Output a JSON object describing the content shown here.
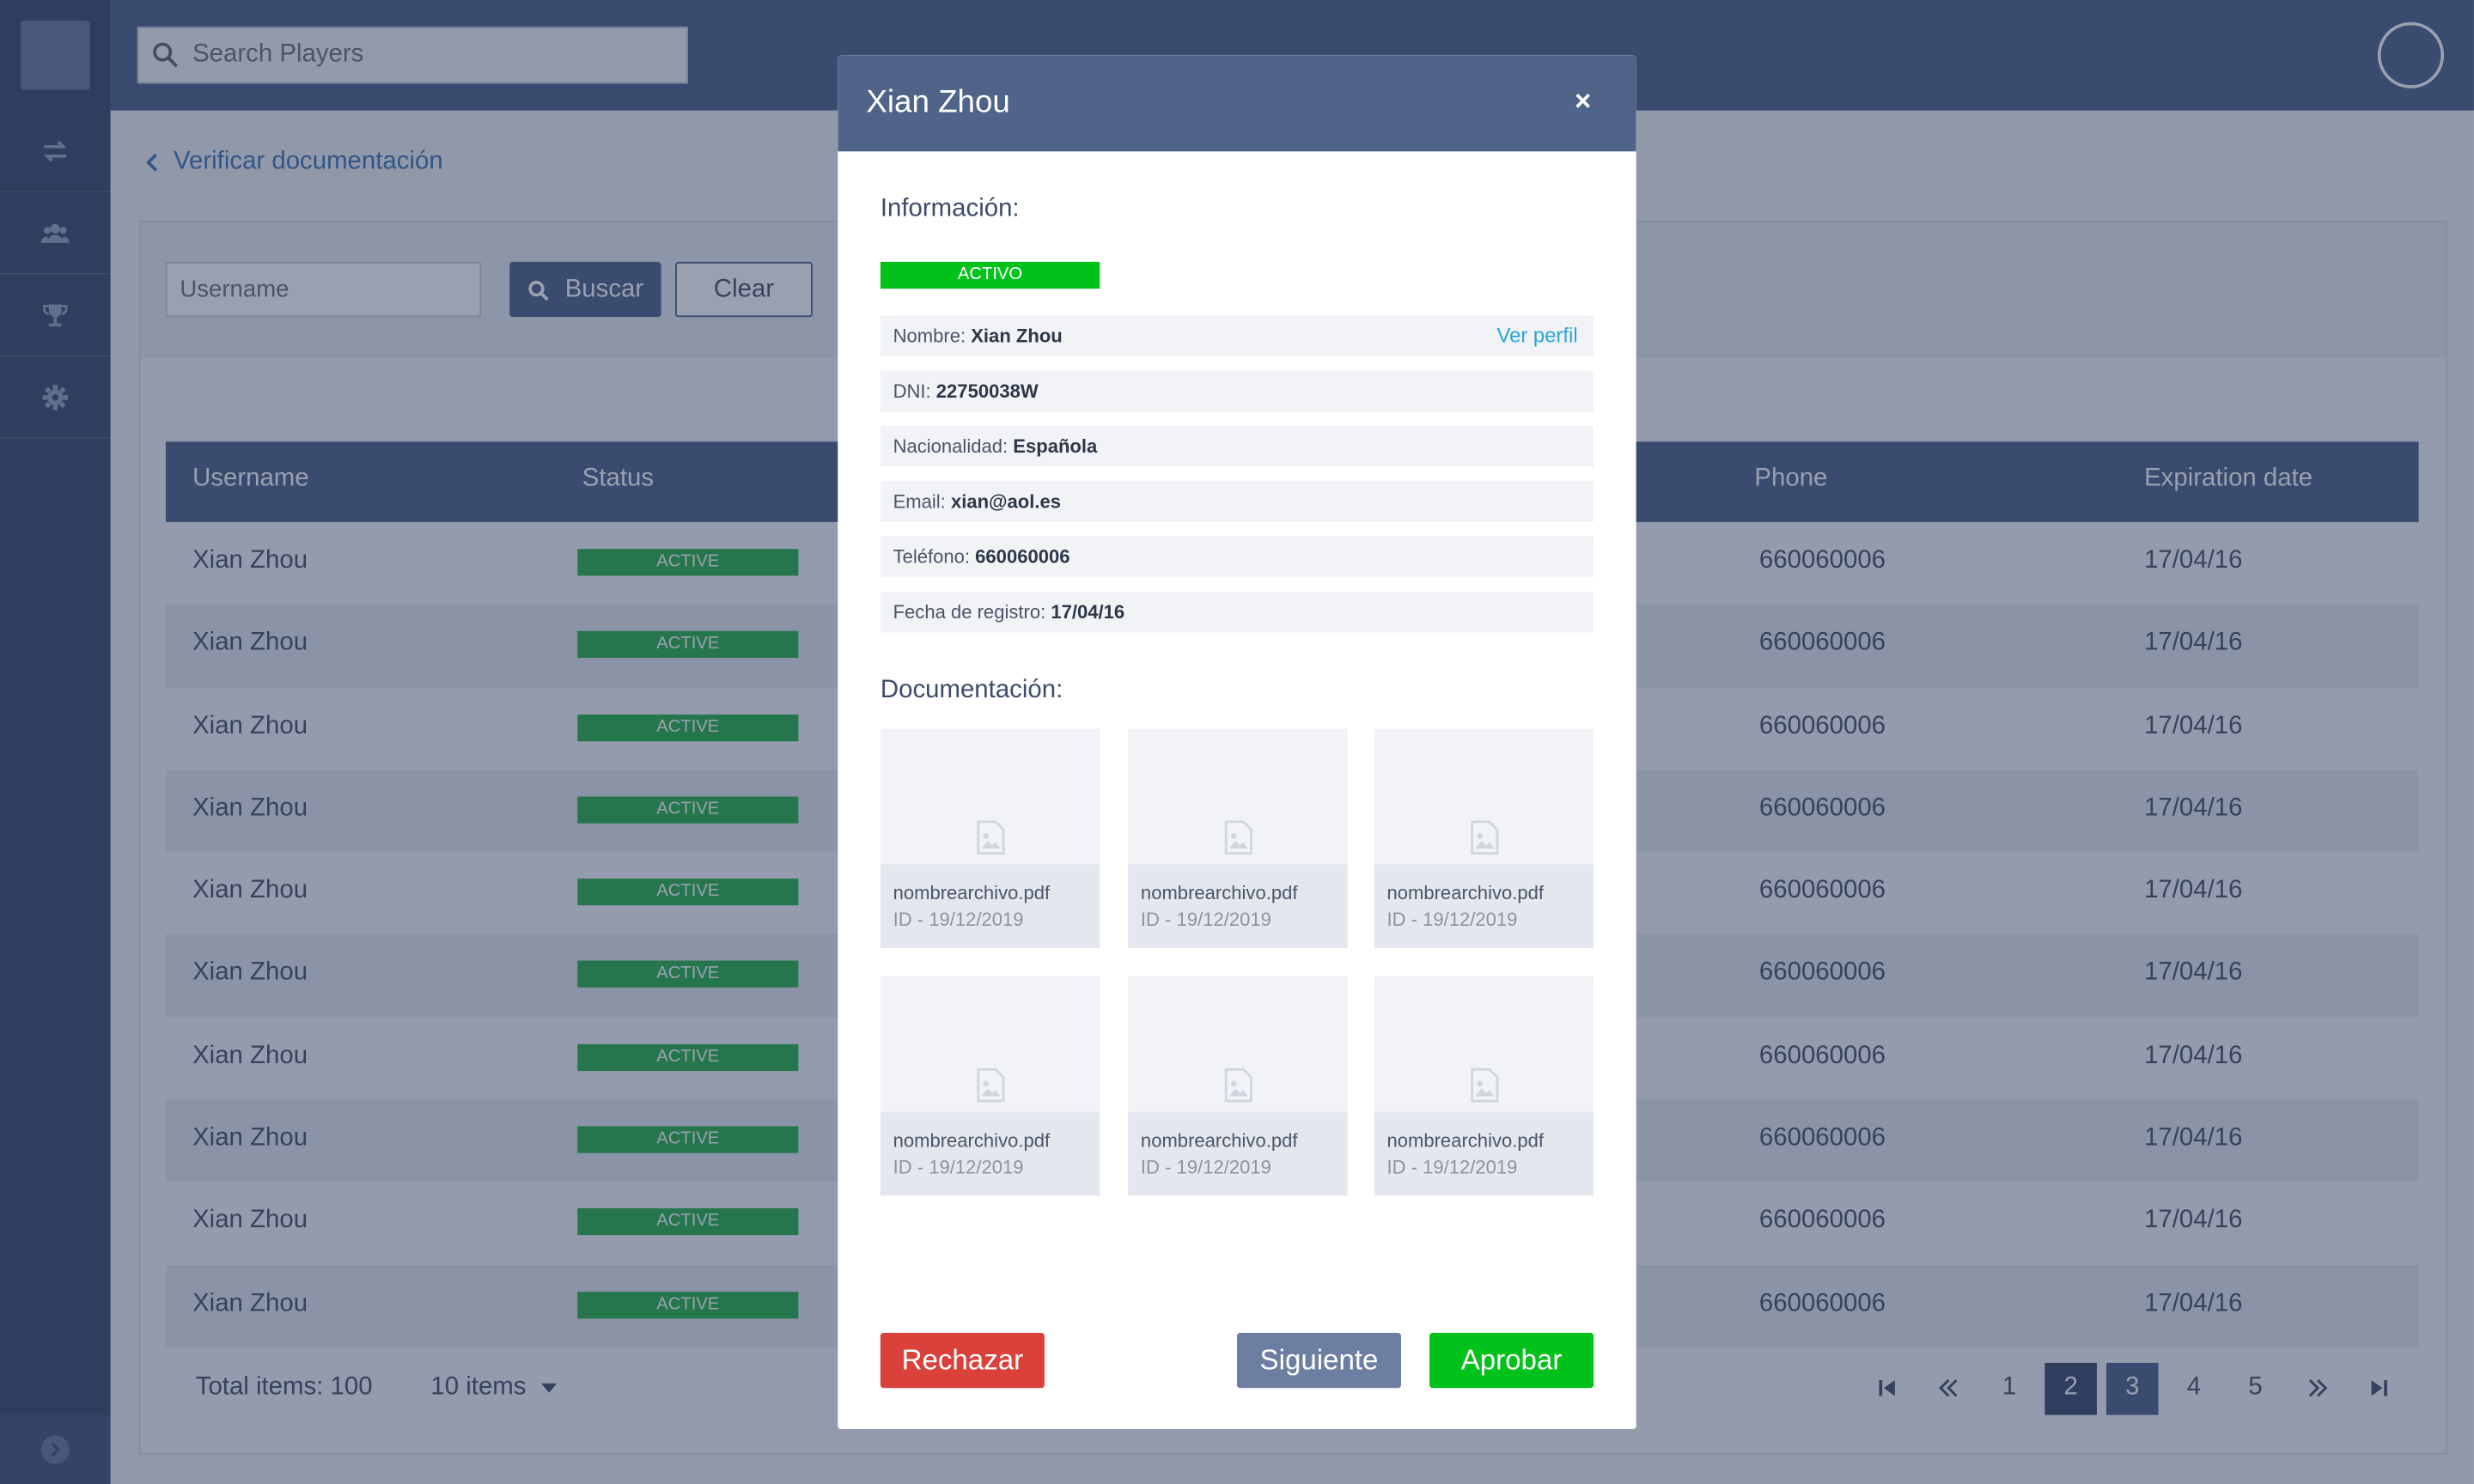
{
  "topbar": {
    "search_placeholder": "Search Players"
  },
  "breadcrumb": {
    "label": "Verificar documentación"
  },
  "filter": {
    "username_placeholder": "Username",
    "buscar_label": "Buscar",
    "clear_label": "Clear"
  },
  "table": {
    "columns": [
      "Username",
      "Status",
      "Phone",
      "Expiration date"
    ],
    "rows": [
      {
        "username": "Xian Zhou",
        "status": "ACTIVE",
        "phone": "660060006",
        "expiration": "17/04/16"
      },
      {
        "username": "Xian Zhou",
        "status": "ACTIVE",
        "phone": "660060006",
        "expiration": "17/04/16"
      },
      {
        "username": "Xian Zhou",
        "status": "ACTIVE",
        "phone": "660060006",
        "expiration": "17/04/16"
      },
      {
        "username": "Xian Zhou",
        "status": "ACTIVE",
        "phone": "660060006",
        "expiration": "17/04/16"
      },
      {
        "username": "Xian Zhou",
        "status": "ACTIVE",
        "phone": "660060006",
        "expiration": "17/04/16"
      },
      {
        "username": "Xian Zhou",
        "status": "ACTIVE",
        "phone": "660060006",
        "expiration": "17/04/16"
      },
      {
        "username": "Xian Zhou",
        "status": "ACTIVE",
        "phone": "660060006",
        "expiration": "17/04/16"
      },
      {
        "username": "Xian Zhou",
        "status": "ACTIVE",
        "phone": "660060006",
        "expiration": "17/04/16"
      },
      {
        "username": "Xian Zhou",
        "status": "ACTIVE",
        "phone": "660060006",
        "expiration": "17/04/16"
      },
      {
        "username": "Xian Zhou",
        "status": "ACTIVE",
        "phone": "660060006",
        "expiration": "17/04/16"
      }
    ]
  },
  "footer": {
    "total_items": "Total items: 100",
    "page_size": "10 items",
    "pages": [
      "1",
      "2",
      "3",
      "4",
      "5"
    ],
    "current_page": "2"
  },
  "modal": {
    "title": "Xian Zhou",
    "close": "×",
    "info_title": "Información:",
    "status_badge": "ACTIVO",
    "ver_perfil": "Ver perfil",
    "info": [
      {
        "label": "Nombre:",
        "value": "Xian Zhou"
      },
      {
        "label": "DNI:",
        "value": "22750038W"
      },
      {
        "label": "Nacionalidad:",
        "value": "Española"
      },
      {
        "label": "Email:",
        "value": "xian@aol.es"
      },
      {
        "label": "Teléfono:",
        "value": "660060006"
      },
      {
        "label": "Fecha de registro:",
        "value": "17/04/16"
      }
    ],
    "docs_title": "Documentación:",
    "documents": [
      {
        "name": "nombrearchivo.pdf",
        "meta": "ID - 19/12/2019"
      },
      {
        "name": "nombrearchivo.pdf",
        "meta": "ID - 19/12/2019"
      },
      {
        "name": "nombrearchivo.pdf",
        "meta": "ID - 19/12/2019"
      },
      {
        "name": "nombrearchivo.pdf",
        "meta": "ID - 19/12/2019"
      },
      {
        "name": "nombrearchivo.pdf",
        "meta": "ID - 19/12/2019"
      },
      {
        "name": "nombrearchivo.pdf",
        "meta": "ID - 19/12/2019"
      }
    ],
    "reject_label": "Rechazar",
    "next_label": "Siguiente",
    "approve_label": "Aprobar"
  },
  "colors": {
    "primary": "#4f6488",
    "sidebar": "#3d4b6b",
    "active_green": "#2bb24c",
    "approve_green": "#00c21a",
    "reject_red": "#d9413a",
    "link_blue": "#27a5d9"
  },
  "icons": [
    "transfer-icon",
    "users-icon",
    "trophy-icon",
    "gear-icon",
    "expand-icon",
    "search-icon",
    "chevron-left-icon",
    "image-icon"
  ]
}
